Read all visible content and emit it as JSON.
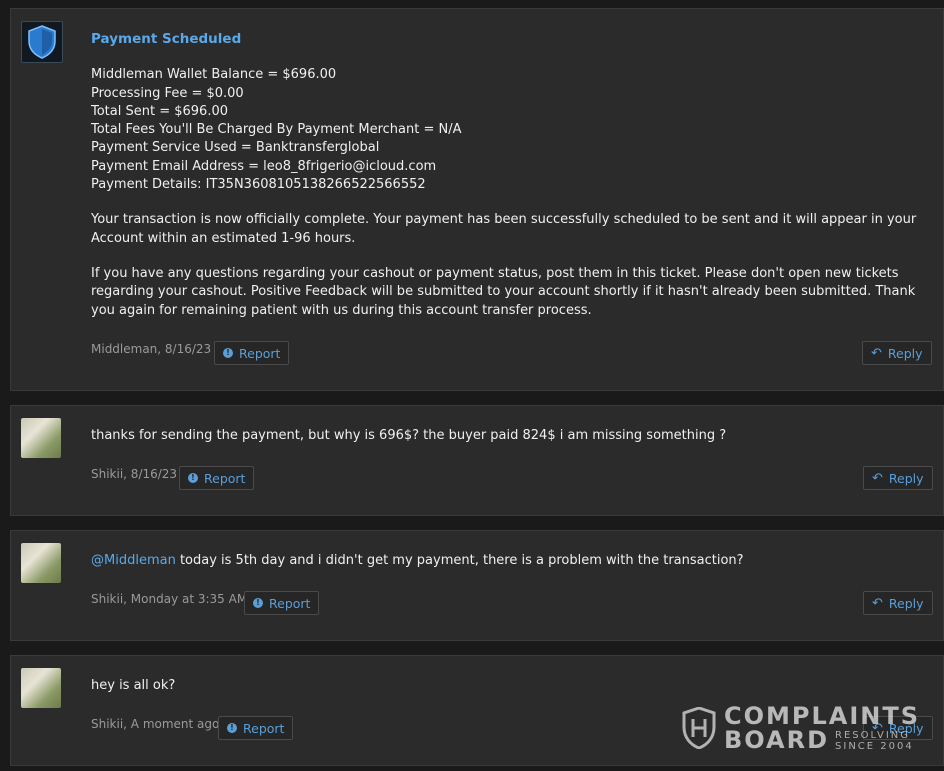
{
  "posts": [
    {
      "title": "Payment Scheduled",
      "lines": [
        "Middleman Wallet Balance = $696.00",
        "Processing Fee = $0.00",
        "Total Sent = $696.00",
        "Total Fees You'll Be Charged By Payment Merchant = N/A",
        "Payment Service Used = Banktransferglobal",
        "Payment Email Address = leo8_8frigerio@icloud.com",
        "Payment Details: IT35N3608105138266522566552"
      ],
      "para1_a": "Your transaction is now officially complete. Your payment has been successfully scheduled to be sent and it will appear in your",
      "para1_b": "Account within an estimated 1-96 hours.",
      "para2_a": "If you have any questions regarding your cashout or payment status, post them in this ticket. Please don't open new tickets",
      "para2_b": "regarding your cashout. Positive Feedback will be submitted to your account shortly if it hasn't already been submitted. Thank",
      "para2_c": "you again for remaining patient with us during this account transfer process.",
      "meta": "Middleman, 8/16/23"
    },
    {
      "text": "thanks for sending the payment, but why is 696$? the buyer paid 824$ i am missing something ?",
      "meta": "Shikii, 8/16/23"
    },
    {
      "mention": "@Middleman",
      "text": " today is 5th day and i didn't get my payment, there is a problem with the transaction?",
      "meta": "Shikii, Monday at 3:35 AM"
    },
    {
      "text": "hey is all ok?",
      "meta": "Shikii, A moment ago"
    }
  ],
  "buttons": {
    "report_label": "Report",
    "reply_label": "Reply"
  },
  "watermark": {
    "line1": "COMPLAINTS",
    "line2": "BOARD",
    "sub1": "RESOLVING",
    "sub2": "SINCE 2004"
  },
  "icons": {
    "staff_avatar": "shield-icon",
    "report": "info-circle-icon",
    "reply": "reply-arrow-icon"
  },
  "colors": {
    "accent": "#5aa8ea",
    "background": "#1a1a1a",
    "post_background": "#2b2b2b"
  }
}
